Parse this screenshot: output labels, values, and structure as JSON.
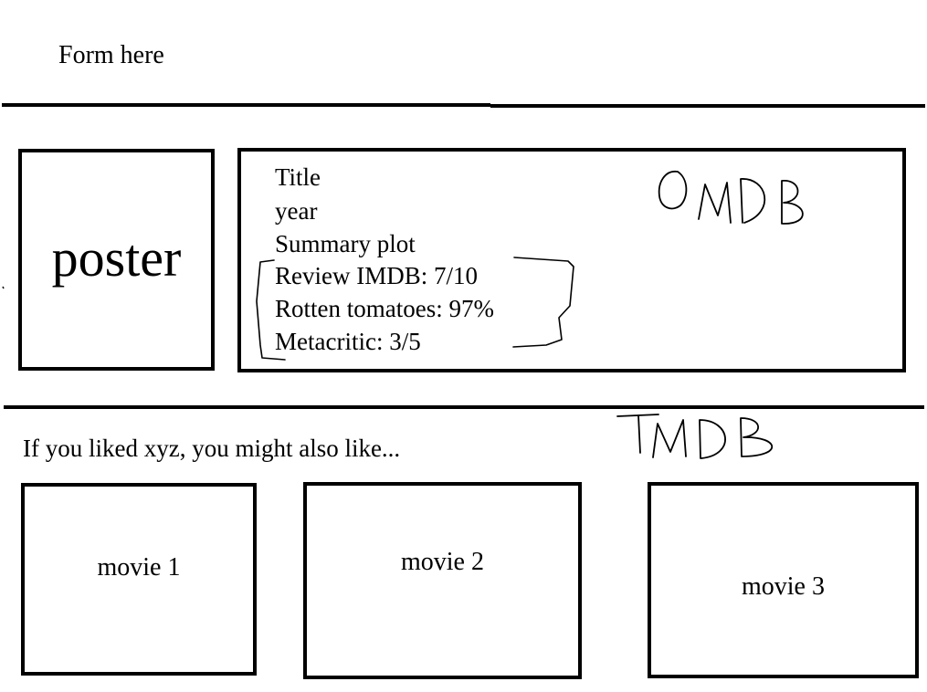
{
  "header": {
    "form_label": "Form here"
  },
  "detail": {
    "poster_label": "poster",
    "title_label": "Title",
    "year_label": "year",
    "summary_label": "Summary plot",
    "review_imdb": "Review IMDB: 7/10",
    "rotten_tomatoes": "Rotten tomatoes: 97%",
    "metacritic": "Metacritic: 3/5",
    "source_note": "OMDB"
  },
  "recommendations": {
    "heading": "If you liked xyz, you might also like...",
    "source_note": "TMDB",
    "movies": [
      {
        "label": "movie 1"
      },
      {
        "label": "movie 2"
      },
      {
        "label": "movie 3"
      }
    ]
  },
  "icons": {
    "ratings_bracket": "handwritten-bracket-icon"
  }
}
